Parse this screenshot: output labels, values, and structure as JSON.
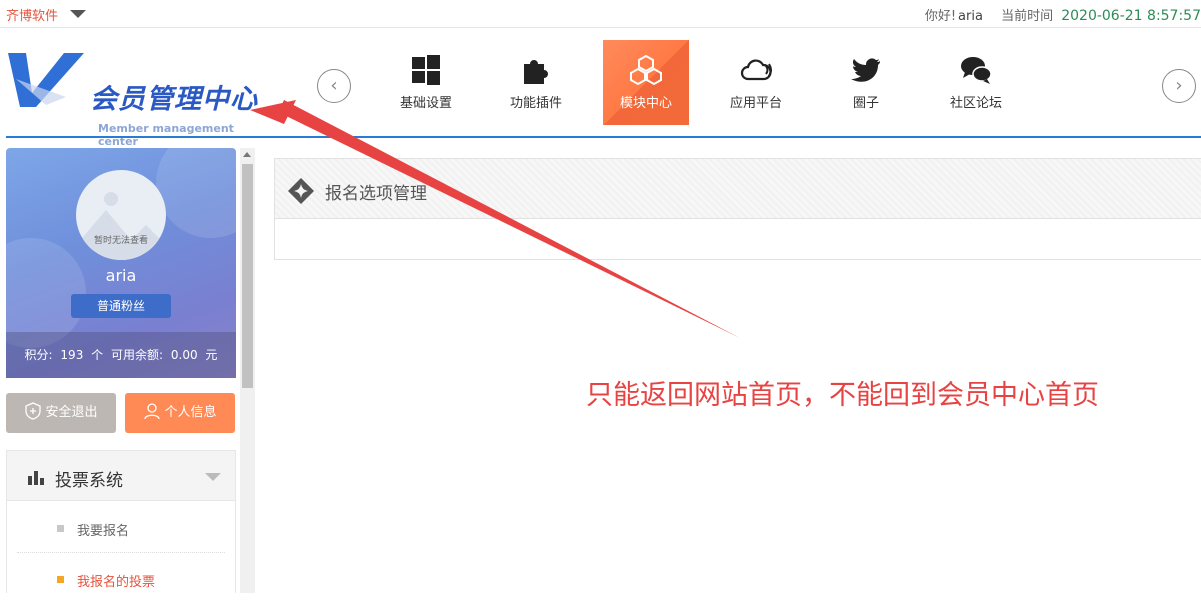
{
  "topbar": {
    "brand": "齐博软件",
    "greeting": "你好!",
    "username": "aria",
    "time_label": "当前时间",
    "time_value": "2020-06-21 8:57:57"
  },
  "logo": {
    "title": "会员管理中心",
    "subtitle": "Member management center"
  },
  "nav": {
    "items": [
      {
        "label": "基础设置",
        "icon": "windows-icon"
      },
      {
        "label": "功能插件",
        "icon": "puzzle-icon"
      },
      {
        "label": "模块中心",
        "icon": "cubes-icon",
        "active": true
      },
      {
        "label": "应用平台",
        "icon": "cloud-icon"
      },
      {
        "label": "圈子",
        "icon": "twitter-bird-icon"
      },
      {
        "label": "社区论坛",
        "icon": "chat-bubbles-icon"
      }
    ]
  },
  "profile": {
    "avatar_text": "暂时无法查看",
    "username": "aria",
    "level": "普通粉丝",
    "points_label": "积分:",
    "points_value": "193",
    "points_unit": "个",
    "balance_label": "可用余额:",
    "balance_value": "0.00",
    "balance_unit": "元"
  },
  "buttons": {
    "logout": "安全退出",
    "info": "个人信息"
  },
  "menu": {
    "title": "投票系统",
    "items": [
      {
        "label": "我要报名"
      },
      {
        "label": "我报名的投票",
        "active": true
      }
    ]
  },
  "panel": {
    "title": "报名选项管理"
  },
  "annotation": {
    "text": "只能返回网站首页，不能回到会员中心首页"
  },
  "colors": {
    "brand": "#e8523d",
    "accent_blue": "#2a7bd4",
    "active_nav": "#ff7a45",
    "annotation_red": "#e84343"
  }
}
